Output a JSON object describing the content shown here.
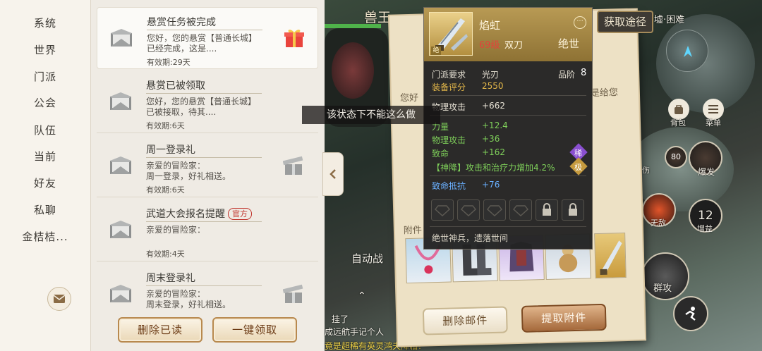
{
  "channels": [
    "系统",
    "世界",
    "门派",
    "公会",
    "队伍",
    "当前",
    "好友",
    "私聊",
    "金桔桔..."
  ],
  "mails": [
    {
      "title": "悬赏任务被完成",
      "body": "您好，您的悬赏【普通长城】已经完成，这是....",
      "expire": "有效期:29天",
      "official": "",
      "attachment": "gift"
    },
    {
      "title": "悬赏已被领取",
      "body": "您好，您的悬赏【普通长城】已被接取，待其....",
      "expire": "有效期:6天",
      "official": "",
      "attachment": ""
    },
    {
      "title": "周一登录礼",
      "body": "亲爱的冒险家：\n周一登录，好礼相送。",
      "expire": "有效期:6天",
      "official": "",
      "attachment": "gift-opened"
    },
    {
      "title": "武道大会报名提醒",
      "body": "亲爱的冒险家：",
      "expire": "有效期:4天",
      "official": "官方",
      "attachment": ""
    },
    {
      "title": "周末登录礼",
      "body": "亲爱的冒险家：\n周末登录，好礼相送。",
      "expire": "有效期:6天",
      "official": "",
      "attachment": "gift-opened"
    }
  ],
  "actions": {
    "delete_read": "删除已读",
    "claim_all": "一键领取"
  },
  "toast": "该状态下不能这么做",
  "letter": {
    "greeting_left": "您好",
    "body_right": "是给您",
    "attach_label": "附件",
    "delete_btn": "删除邮件",
    "claim_btn": "提取附件"
  },
  "item": {
    "name": "焰虹",
    "level": "69级",
    "kind": "双刀",
    "grade": "绝世",
    "grade_badge": "绝",
    "req_label": "门派要求",
    "req_value": "光刃",
    "tier_label": "品阶",
    "tier_value": "8",
    "score_label": "装备评分",
    "score_value": "2550",
    "base_stat": {
      "label": "物理攻击",
      "value": "+662"
    },
    "stats": [
      {
        "label": "力量",
        "value": "+12.4"
      },
      {
        "label": "物理攻击",
        "value": "+36"
      },
      {
        "label": "致命",
        "value": "+162"
      }
    ],
    "special": "【神降】攻击和治疗力增加4.2%",
    "rare_badge": "稀",
    "extreme_badge": "极",
    "resist": {
      "label": "致命抵抗",
      "value": "+76"
    },
    "flavor": "绝世神兵，遗落世间",
    "get_btn": "获取途径"
  },
  "hud": {
    "boss_name": "兽王",
    "dungeon": "墟·困难",
    "auto_battle": "自动战",
    "bag": "背包",
    "menu": "菜单",
    "skill_1": "爆发",
    "skill_2": "无敌",
    "skill_3": "增益",
    "skill_3_count": "12",
    "skill_cd": "80",
    "skill_4": "群攻",
    "skill_partial": "伤",
    "chat_1": "挂了",
    "chat_2": "成远航手记个人",
    "chat_3": "竟是超稀有英灵鸿夫降临！"
  },
  "colors": {
    "accent_tan": "#b8894e",
    "tooltip_bg": "#222222",
    "stat_green": "#7fd05a",
    "score_gold": "#e4b84a",
    "level_red": "#e0443a",
    "resist_blue": "#6ab0ff"
  }
}
